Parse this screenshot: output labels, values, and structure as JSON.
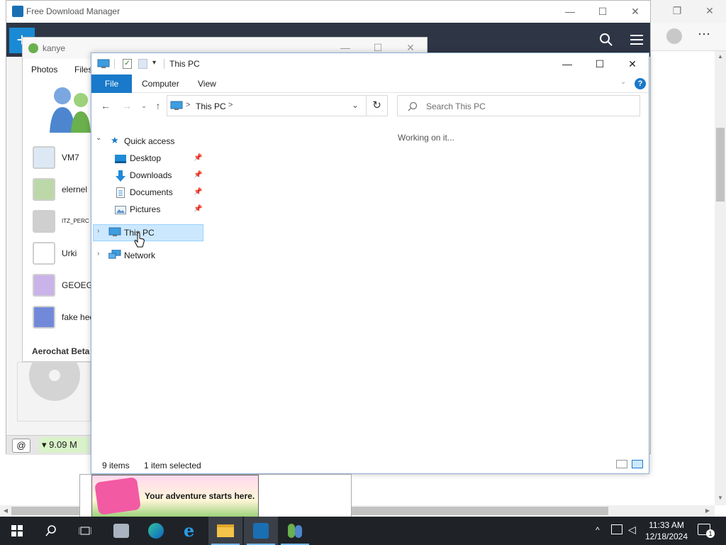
{
  "fdm": {
    "title": "Free Download Manager",
    "speed": "▾ 9.09 M"
  },
  "aerochat": {
    "title": "kanye",
    "menu": [
      "Photos",
      "Files"
    ],
    "contacts": [
      {
        "name": "VM7"
      },
      {
        "name": "elernel"
      },
      {
        "name": "ITZ_PERC"
      },
      {
        "name": "Urki"
      },
      {
        "name": "GEOEGI"
      },
      {
        "name": "fake hec"
      }
    ],
    "footer": "Aerochat Beta"
  },
  "explorer": {
    "title": "This PC",
    "tabs": {
      "file": "File",
      "computer": "Computer",
      "view": "View"
    },
    "address": {
      "location": "This PC",
      "separator": ">"
    },
    "search_placeholder": "Search This PC",
    "working": "Working on it...",
    "nav": {
      "quick_access": "Quick access",
      "items": [
        {
          "label": "Desktop",
          "icon": "desktop-folder-icon"
        },
        {
          "label": "Downloads",
          "icon": "downloads-folder-icon"
        },
        {
          "label": "Documents",
          "icon": "documents-folder-icon"
        },
        {
          "label": "Pictures",
          "icon": "pictures-folder-icon"
        }
      ],
      "this_pc": "This PC",
      "network": "Network"
    },
    "status": {
      "items": "9 items",
      "selected": "1 item selected"
    }
  },
  "ad": {
    "text": "Your adventure starts here."
  },
  "taskbar": {
    "time": "11:33 AM",
    "date": "12/18/2024",
    "notification_count": "1"
  },
  "colors": {
    "accent": "#1979ca",
    "selection": "#cce8ff",
    "taskbar": "#1f2328",
    "fdm_bar": "#2e3646"
  }
}
